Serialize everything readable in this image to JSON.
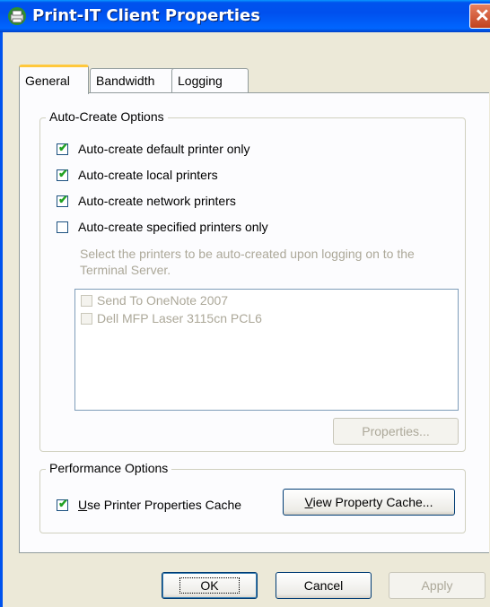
{
  "window": {
    "title": "Print-IT Client Properties",
    "icon": "printer-app-icon",
    "close_glyph": "✕"
  },
  "tabs": [
    {
      "label": "General",
      "active": true
    },
    {
      "label": "Bandwidth",
      "active": false
    },
    {
      "label": "Logging",
      "active": false
    }
  ],
  "auto_create": {
    "legend": "Auto-Create Options",
    "options": [
      {
        "label": "Auto-create default printer only",
        "checked": true
      },
      {
        "label": "Auto-create local printers",
        "checked": true
      },
      {
        "label": "Auto-create network printers",
        "checked": true
      },
      {
        "label": "Auto-create specified printers only",
        "checked": false
      }
    ],
    "hint_line1": "Select the printers to be auto-created upon logging on to the",
    "hint_line2": "Terminal Server.",
    "printers": [
      {
        "name": "Send To OneNote 2007",
        "checked": false
      },
      {
        "name": "Dell MFP Laser 3115cn PCL6",
        "checked": false
      }
    ],
    "properties_button": "Properties..."
  },
  "performance": {
    "legend": "Performance Options",
    "cache_checkbox_first": "U",
    "cache_checkbox_rest": "se Printer Properties Cache",
    "cache_checked": true,
    "view_cache_first": "V",
    "view_cache_rest": "iew Property Cache..."
  },
  "footer": {
    "ok": "OK",
    "cancel": "Cancel",
    "apply": "Apply"
  },
  "colors": {
    "titlebar": "#0053ee",
    "dialog_bg": "#ece9d8",
    "panel_bg": "#fcfcfe",
    "tab_highlight": "#ffc83c",
    "disabled_text": "#aca899"
  }
}
